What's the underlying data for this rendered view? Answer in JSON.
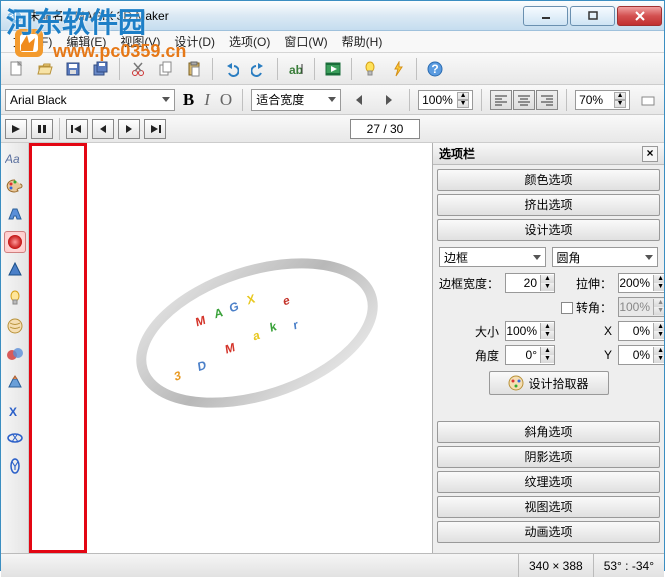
{
  "title": "未命名 - MAGIX 3D Maker",
  "watermark": {
    "site": "河东软件园",
    "url": "www.pc0359.cn"
  },
  "menu": {
    "file": "文件(F)",
    "edit": "编辑(E)",
    "view": "视图(V)",
    "design": "设计(D)",
    "option": "选项(O)",
    "window": "窗口(W)",
    "help": "帮助(H)"
  },
  "toolbar2": {
    "font": "Arial Black",
    "fit": "适合宽度",
    "zoom1": "100%",
    "zoom2": "70%"
  },
  "playback": {
    "frame": "27 / 30"
  },
  "panel": {
    "title": "选项栏",
    "btn_color": "颜色选项",
    "btn_extrude": "挤出选项",
    "btn_design": "设计选项",
    "border_label": "边框",
    "corner_label": "圆角",
    "bw_label": "边框宽度：",
    "bw_val": "20",
    "stretch_label": "拉伸：",
    "stretch_val": "200%",
    "rotate_label": "转角：",
    "rotate_val": "100%",
    "size_label": "大小",
    "size_val": "100%",
    "x_label": "X",
    "x_val": "0%",
    "angle_label": "角度",
    "angle_val": "0°",
    "y_label": "Y",
    "y_val": "0%",
    "picker": "设计拾取器",
    "btn_bevel": "斜角选项",
    "btn_shadow": "阴影选项",
    "btn_texture": "纹理选项",
    "btn_viewopt": "视图选项",
    "btn_anim": "动画选项"
  },
  "status": {
    "dims": "340 × 388",
    "angles": "53° : -34°"
  }
}
